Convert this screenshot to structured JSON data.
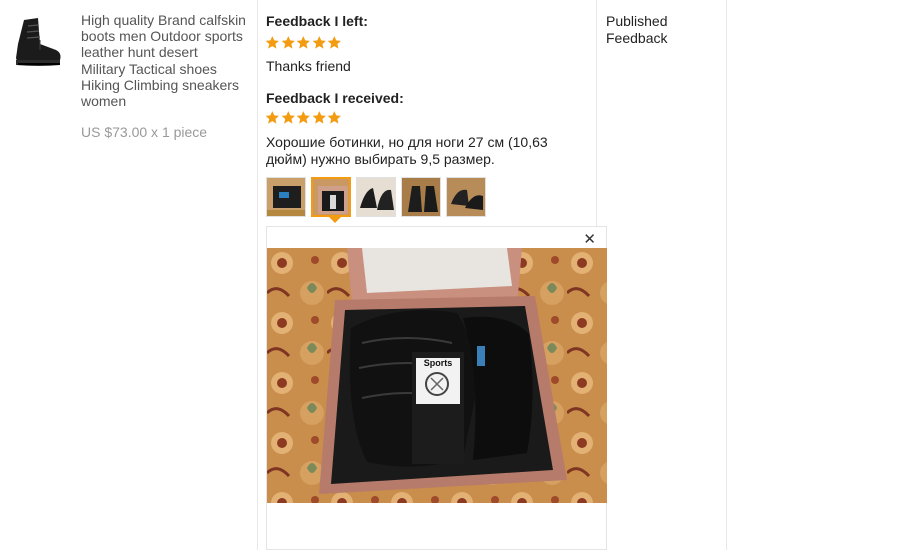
{
  "product": {
    "image_icon": "black-tactical-boot",
    "title_lines": [
      "High quality Brand calfskin",
      "boots men Outdoor sports",
      "leather hunt desert",
      "Military Tactical shoes",
      "Hiking Climbing sneakers",
      "women"
    ],
    "price": "US $73.00 x 1 piece"
  },
  "feedback_left": {
    "label": "Feedback I left:",
    "stars": 5,
    "text": "Thanks friend"
  },
  "feedback_received": {
    "label": "Feedback I received:",
    "stars": 5,
    "text_lines": [
      "Хорошие ботинки, но для ноги 27 см (10,63",
      "дюйм) нужно выбирать 9,5 размер."
    ],
    "photos": [
      {
        "name": "photo-1",
        "active": false
      },
      {
        "name": "photo-2",
        "active": true
      },
      {
        "name": "photo-3",
        "active": false
      },
      {
        "name": "photo-4",
        "active": false
      },
      {
        "name": "photo-5",
        "active": false
      }
    ]
  },
  "viewer": {
    "close_label": "✕",
    "socks_label": "Sports"
  },
  "status": {
    "lines": [
      "Published",
      "Feedback"
    ]
  },
  "colors": {
    "star": "#f39c12",
    "active_border": "#f39c12",
    "price": "#999999"
  }
}
